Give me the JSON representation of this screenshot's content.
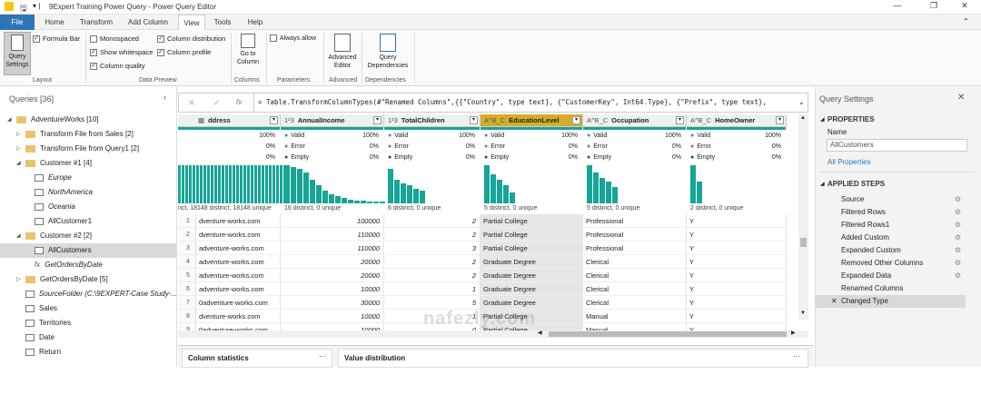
{
  "window": {
    "title": "9Expert Training Power Query - Power Query Editor"
  },
  "tabs": [
    "File",
    "Home",
    "Transform",
    "Add Column",
    "View",
    "Tools",
    "Help"
  ],
  "ribbon": {
    "query_settings": "Query Settings",
    "formula_bar": "Formula Bar",
    "layout_group": "Layout",
    "monospaced": "Monospaced",
    "show_whitespace": "Show whitespace",
    "column_quality": "Column quality",
    "column_distribution": "Column distribution",
    "column_profile": "Column profile",
    "data_preview_group": "Data Preview",
    "go_to_column": "Go to Column",
    "columns_group": "Columns",
    "always_allow": "Always allow",
    "parameters_group": "Parameters",
    "advanced_editor": "Advanced Editor",
    "advanced_group": "Advanced",
    "query_dependencies": "Query Dependencies",
    "dependencies_group": "Dependencies"
  },
  "queries": {
    "header": "Queries [36]",
    "items": [
      {
        "label": "AdventureWorks [10]",
        "type": "folder",
        "level": 0,
        "arrow": "◢"
      },
      {
        "label": "Transform File from Sales [2]",
        "type": "folder",
        "level": 1,
        "arrow": "▷"
      },
      {
        "label": "Transform File from Query1 [2]",
        "type": "folder",
        "level": 1,
        "arrow": "▷"
      },
      {
        "label": "Customer #1 [4]",
        "type": "folder",
        "level": 1,
        "arrow": "◢"
      },
      {
        "label": "Europe",
        "type": "table",
        "level": 2,
        "italic": true
      },
      {
        "label": "NorthAmerica",
        "type": "table",
        "level": 2,
        "italic": true
      },
      {
        "label": "Oceania",
        "type": "table",
        "level": 2,
        "italic": true
      },
      {
        "label": "AllCustomer1",
        "type": "table",
        "level": 2
      },
      {
        "label": "Customer #2 [2]",
        "type": "folder",
        "level": 1,
        "arrow": "◢"
      },
      {
        "label": "AllCustomers",
        "type": "table",
        "level": 2,
        "selected": true
      },
      {
        "label": "GetOrdersByDate",
        "type": "fx",
        "level": 2,
        "italic": true
      },
      {
        "label": "GetOrdersByDate [5]",
        "type": "folder",
        "level": 1,
        "arrow": "▷"
      },
      {
        "label": "SourceFolder (C:\\9EXPERT-Case Study-...",
        "type": "table",
        "level": 1,
        "italic": true
      },
      {
        "label": "Sales",
        "type": "table",
        "level": 1
      },
      {
        "label": "Territories",
        "type": "table",
        "level": 1
      },
      {
        "label": "Date",
        "type": "table",
        "level": 1
      },
      {
        "label": "Return",
        "type": "table",
        "level": 1
      }
    ]
  },
  "formula": "= Table.TransformColumnTypes(#\"Renamed Columns\",{{\"Country\", type text}, {\"CustomerKey\", Int64.Type}, {\"Prefix\", type text},",
  "grid": {
    "columns": [
      {
        "name": "ddress",
        "type_icon": "▦",
        "width": 113,
        "valid": "100%",
        "error": "0%",
        "empty": "0%",
        "distinct": "nct, 18148 distinct, 18148 unique",
        "bars": [
          42,
          42,
          42,
          42,
          42,
          42,
          42,
          42,
          42,
          42,
          42,
          42,
          42,
          42,
          42,
          42,
          42,
          42,
          42,
          42,
          42,
          42,
          42,
          42,
          42,
          42,
          42,
          42,
          42,
          42
        ],
        "show_labels": false
      },
      {
        "name": "AnnualIncome",
        "type_icon": "1²3",
        "width": 114,
        "valid": "100%",
        "error": "0%",
        "empty": "0%",
        "distinct": "16 distinct, 0 unique",
        "bars": [
          42,
          40,
          38,
          34,
          26,
          20,
          14,
          10,
          8,
          6,
          4,
          3,
          3,
          2,
          2,
          2
        ]
      },
      {
        "name": "TotalChildren",
        "type_icon": "1²3",
        "width": 106,
        "valid": "100%",
        "error": "0%",
        "empty": "0%",
        "distinct": "6 distinct, 0 unique",
        "bars": [
          38,
          26,
          22,
          20,
          16,
          14
        ]
      },
      {
        "name": "EducationLevel",
        "type_icon": "A^B_C",
        "width": 113,
        "valid": "100%",
        "error": "0%",
        "empty": "0%",
        "distinct": "5 distinct, 0 unique",
        "bars": [
          42,
          32,
          26,
          20,
          12
        ],
        "highlight": true
      },
      {
        "name": "Occupation",
        "type_icon": "A^B_C",
        "width": 114,
        "valid": "100%",
        "error": "0%",
        "empty": "0%",
        "distinct": "5 distinct, 0 unique",
        "bars": [
          42,
          34,
          28,
          24,
          18
        ]
      },
      {
        "name": "HomeOwner",
        "type_icon": "A^B_C",
        "width": 110,
        "valid": "100%",
        "error": "0%",
        "empty": "0%",
        "distinct": "2 distinct, 0 unique",
        "bars": [
          42,
          24
        ]
      }
    ],
    "labels": {
      "valid": "Valid",
      "error": "Error",
      "empty": "Empty"
    },
    "rows": [
      [
        "1",
        "dventure-works.com",
        "100000",
        "2",
        "Partial College",
        "Professional",
        "Y"
      ],
      [
        "2",
        "dventure-works.com",
        "110000",
        "2",
        "Partial College",
        "Professional",
        "Y"
      ],
      [
        "3",
        "adventure-works.com",
        "110000",
        "3",
        "Partial College",
        "Professional",
        "Y"
      ],
      [
        "4",
        "adventure-works.com",
        "20000",
        "2",
        "Graduate Degree",
        "Clerical",
        "Y"
      ],
      [
        "5",
        "adventure-works.com",
        "20000",
        "2",
        "Graduate Degree",
        "Clerical",
        "Y"
      ],
      [
        "6",
        "adventure-works.com",
        "10000",
        "1",
        "Graduate Degree",
        "Clerical",
        "Y"
      ],
      [
        "7",
        "0adventure-works.com",
        "30000",
        "5",
        "Graduate Degree",
        "Clerical",
        "Y"
      ],
      [
        "8",
        "dventure-works.com",
        "10000",
        "1",
        "Partial College",
        "Manual",
        "Y"
      ],
      [
        "9",
        "0adventure-works.com",
        "10000",
        "0",
        "Partial College",
        "Manual",
        "Y"
      ]
    ]
  },
  "bottom": {
    "column_statistics": "Column statistics",
    "value_distribution": "Value distribution",
    "more": "···"
  },
  "query_settings": {
    "title": "Query Settings",
    "properties": "PROPERTIES",
    "name_label": "Name",
    "name_value": "AllCustomers",
    "all_properties": "All Properties",
    "applied_steps": "APPLIED STEPS",
    "steps": [
      {
        "label": "Source",
        "gear": true
      },
      {
        "label": "Filtered Rows",
        "gear": true
      },
      {
        "label": "Filtered Rows1",
        "gear": true
      },
      {
        "label": "Added Custom",
        "gear": true
      },
      {
        "label": "Expanded Custom",
        "gear": true
      },
      {
        "label": "Removed Other Columns",
        "gear": true
      },
      {
        "label": "Expanded Data",
        "gear": true
      },
      {
        "label": "Renamed Columns",
        "gear": false
      },
      {
        "label": "Changed Type",
        "gear": false,
        "selected": true
      }
    ]
  },
  "watermark": "nafezly.com",
  "colors": {
    "accent": "#2e75b6",
    "teal": "#16a596",
    "highlight": "#d4ae2a"
  }
}
